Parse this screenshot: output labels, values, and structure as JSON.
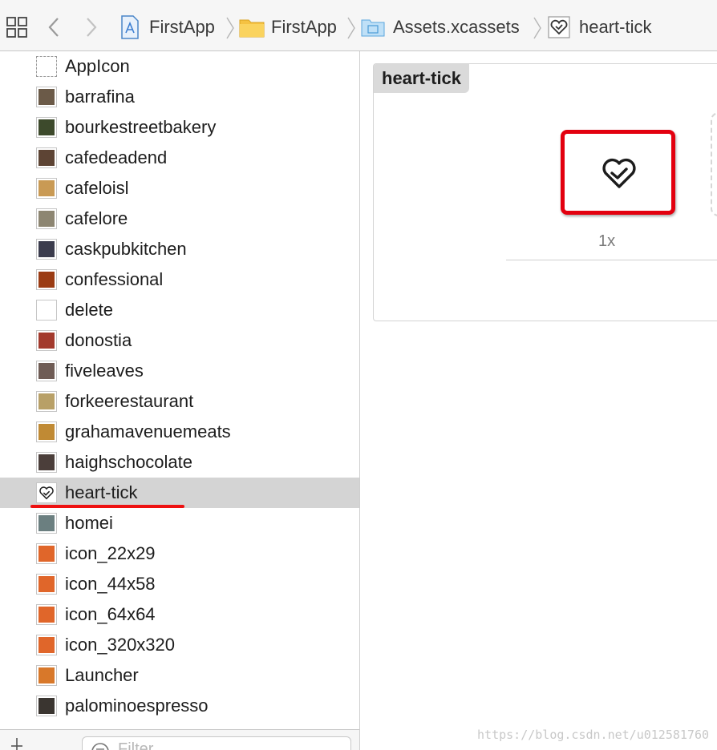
{
  "breadcrumb": {
    "items": [
      {
        "label": "FirstApp",
        "icon": "project-file-icon"
      },
      {
        "label": "FirstApp",
        "icon": "folder-icon"
      },
      {
        "label": "Assets.xcassets",
        "icon": "asset-catalog-icon"
      },
      {
        "label": "heart-tick",
        "icon": "image-set-icon"
      }
    ]
  },
  "sidebar": {
    "assets": [
      {
        "label": "AppIcon",
        "thumb": "#ffffff"
      },
      {
        "label": "barrafina",
        "thumb": "#6b5a48"
      },
      {
        "label": "bourkestreetbakery",
        "thumb": "#3d4a2c"
      },
      {
        "label": "cafedeadend",
        "thumb": "#5d4434"
      },
      {
        "label": "cafeloisl",
        "thumb": "#c99a54"
      },
      {
        "label": "cafelore",
        "thumb": "#8d8672"
      },
      {
        "label": "caskpubkitchen",
        "thumb": "#3b3c4d"
      },
      {
        "label": "confessional",
        "thumb": "#9b3c14"
      },
      {
        "label": "delete",
        "thumb": "#ffffff"
      },
      {
        "label": "donostia",
        "thumb": "#a33a2d"
      },
      {
        "label": "fiveleaves",
        "thumb": "#6f5c55"
      },
      {
        "label": "forkeerestaurant",
        "thumb": "#b8a067"
      },
      {
        "label": "grahamavenuemeats",
        "thumb": "#c08a34"
      },
      {
        "label": "haighschocolate",
        "thumb": "#4b3e3a"
      },
      {
        "label": "heart-tick",
        "thumb": "heart"
      },
      {
        "label": "homei",
        "thumb": "#6b7f80"
      },
      {
        "label": "icon_22x29",
        "thumb": "#e0662a"
      },
      {
        "label": "icon_44x58",
        "thumb": "#e0662a"
      },
      {
        "label": "icon_64x64",
        "thumb": "#e0662a"
      },
      {
        "label": "icon_320x320",
        "thumb": "#e0662a"
      },
      {
        "label": "Launcher",
        "thumb": "#d8782a"
      },
      {
        "label": "palominoespresso",
        "thumb": "#3a3530"
      }
    ],
    "selected": "heart-tick",
    "filter_placeholder": "Filter"
  },
  "editor": {
    "asset_title": "heart-tick",
    "slot_label": "1x"
  },
  "colors": {
    "selection": "#d4d4d4",
    "highlight_red": "#e3000f"
  },
  "watermark": "https://blog.csdn.net/u012581760"
}
